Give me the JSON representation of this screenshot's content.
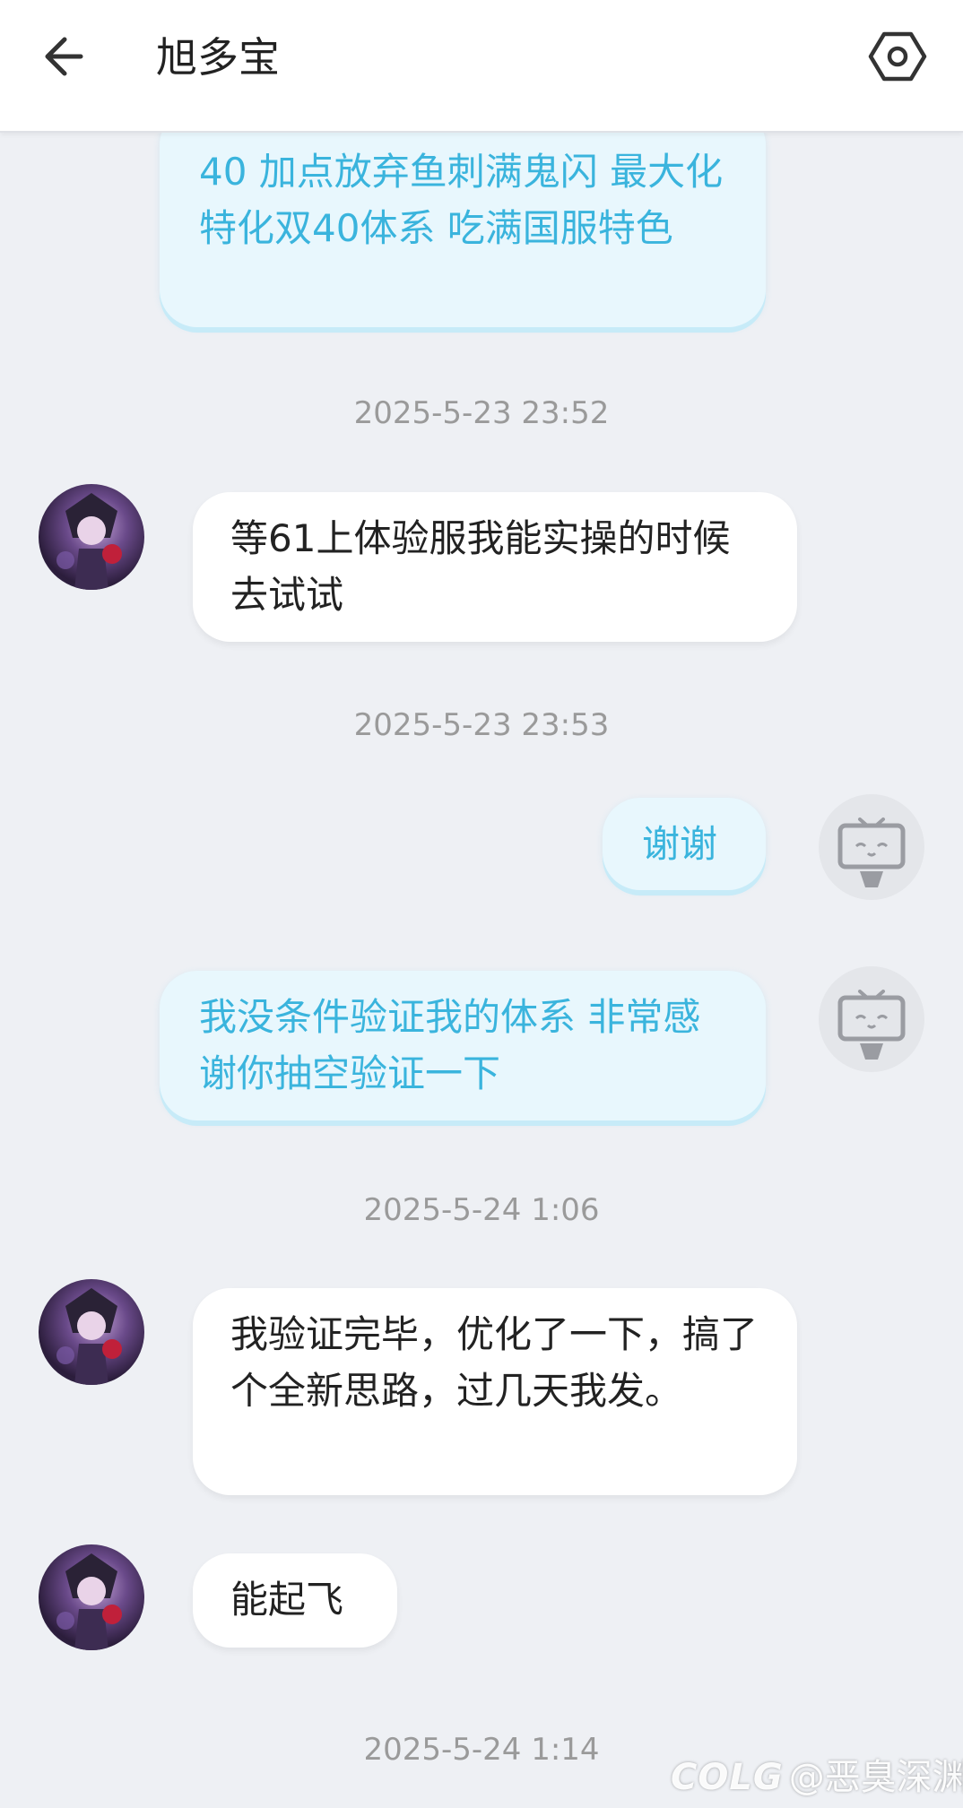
{
  "header": {
    "title": "旭多宝",
    "back_icon": "back-arrow-icon",
    "settings_icon": "hexagon-settings-icon"
  },
  "messages": [
    {
      "side": "me",
      "text": "40 加点放弃鱼刺满鬼闪   最大化特化双40体系 吃满国服特色"
    },
    {
      "timestamp": "2025-5-23 23:52"
    },
    {
      "side": "them",
      "text": "等61上体验服我能实操的时候去试试"
    },
    {
      "timestamp": "2025-5-23 23:53"
    },
    {
      "side": "me",
      "text": "谢谢"
    },
    {
      "side": "me",
      "text": "我没条件验证我的体系  非常感谢你抽空验证一下"
    },
    {
      "timestamp": "2025-5-24 1:06"
    },
    {
      "side": "them",
      "text": "我验证完毕，优化了一下，搞了个全新思路，过几天我发。"
    },
    {
      "side": "them",
      "text": "能起飞"
    },
    {
      "timestamp": "2025-5-24 1:14"
    }
  ],
  "watermark": {
    "logo": "COLG",
    "text": "@恶臭深渊"
  },
  "colors": {
    "background": "#eef0f4",
    "my_bubble": "#e8f7fd",
    "my_text": "#3ab4dd",
    "their_bubble": "#ffffff",
    "their_text": "#222222"
  }
}
